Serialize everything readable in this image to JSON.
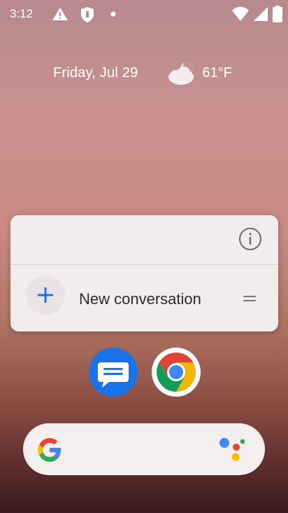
{
  "status_bar": {
    "time": "3:12",
    "left_icons": [
      "alert-icon",
      "shield-icon",
      "dot-icon"
    ],
    "right_icons": [
      "wifi-icon",
      "signal-icon",
      "battery-icon"
    ]
  },
  "at_a_glance": {
    "date": "Friday, Jul 29",
    "weather_icon": "cloudy-night-icon",
    "temperature": "61°F"
  },
  "shortcut_popup": {
    "info_icon": "info-icon",
    "item_label": "New conversation",
    "item_icon": "plus-icon",
    "drag_handle_icon": "drag-handle-icon"
  },
  "home_apps": [
    {
      "name": "Messages",
      "icon": "messages-icon"
    },
    {
      "name": "Chrome",
      "icon": "chrome-icon"
    }
  ],
  "search_bar": {
    "logo_icon": "google-g-icon",
    "assistant_icon": "google-assistant-icon"
  }
}
